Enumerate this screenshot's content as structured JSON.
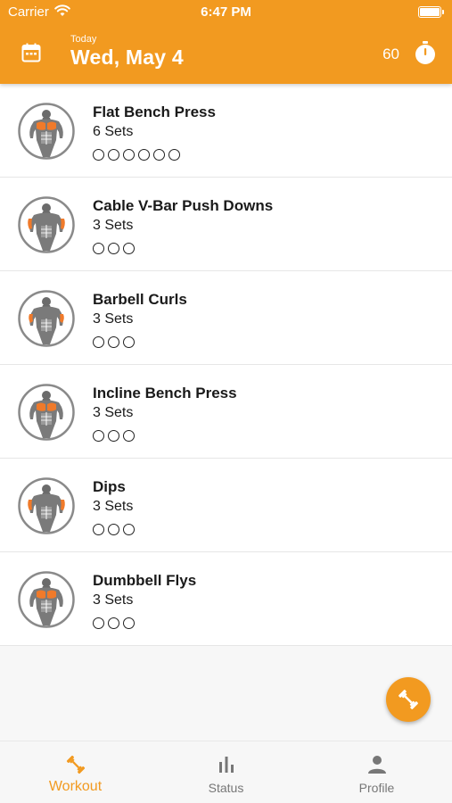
{
  "status_bar": {
    "carrier": "Carrier",
    "time": "6:47 PM"
  },
  "header": {
    "subtitle": "Today",
    "date": "Wed, May 4",
    "timer_value": "60",
    "accent_color": "#f29a20",
    "calendar_icon": "calendar-icon",
    "timer_icon": "stopwatch-icon"
  },
  "exercises": [
    {
      "name": "Flat Bench Press",
      "sets_label": "6 Sets",
      "sets": 6,
      "highlight": "chest"
    },
    {
      "name": "Cable V-Bar Push Downs",
      "sets_label": "3 Sets",
      "sets": 3,
      "highlight": "triceps"
    },
    {
      "name": "Barbell Curls",
      "sets_label": "3 Sets",
      "sets": 3,
      "highlight": "biceps"
    },
    {
      "name": "Incline Bench Press",
      "sets_label": "3 Sets",
      "sets": 3,
      "highlight": "chest"
    },
    {
      "name": "Dips",
      "sets_label": "3 Sets",
      "sets": 3,
      "highlight": "triceps"
    },
    {
      "name": "Dumbbell Flys",
      "sets_label": "3 Sets",
      "sets": 3,
      "highlight": "chest"
    }
  ],
  "fab": {
    "icon": "dumbbell-icon"
  },
  "tabs": [
    {
      "label": "Workout",
      "icon": "dumbbell-icon",
      "active": true
    },
    {
      "label": "Status",
      "icon": "bar-chart-icon",
      "active": false
    },
    {
      "label": "Profile",
      "icon": "person-icon",
      "active": false
    }
  ]
}
